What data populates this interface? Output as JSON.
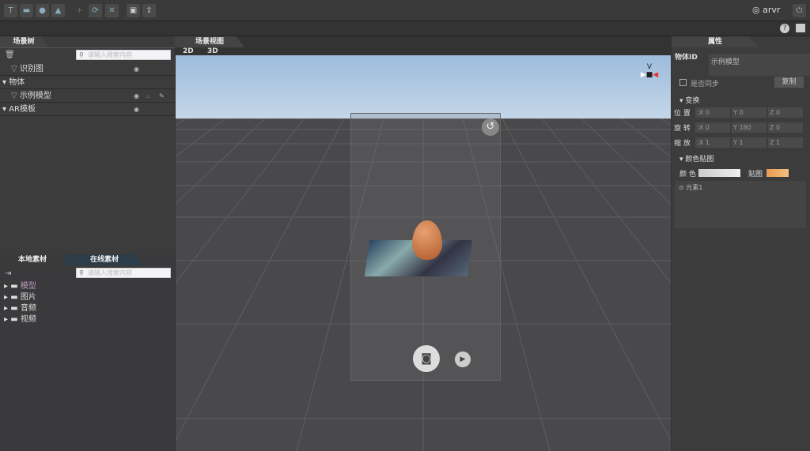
{
  "user": {
    "name": "arvr"
  },
  "toolbar": {
    "icons": [
      "text-icon",
      "camera-icon",
      "location-icon",
      "image-icon",
      "add-icon",
      "refresh-icon",
      "fullscreen-icon",
      "save-icon",
      "export-icon"
    ]
  },
  "scene_tree": {
    "tab": "场景树",
    "search_placeholder": "请输入搜索内容",
    "items": [
      {
        "label": "识别图",
        "type": "child"
      },
      {
        "label": "物体",
        "type": "group"
      },
      {
        "label": "示例模型",
        "type": "child"
      },
      {
        "label": "AR模板",
        "type": "group"
      }
    ]
  },
  "assets": {
    "tabs": [
      "本地素材",
      "在线素材"
    ],
    "search_placeholder": "请输入搜索内容",
    "folders": [
      "模型",
      "图片",
      "音频",
      "视频"
    ]
  },
  "scene_view": {
    "tab": "场景视图",
    "modes": [
      "2D",
      "3D"
    ]
  },
  "properties": {
    "tab": "属性",
    "object_id_label": "物体ID",
    "object_id": "示例模型",
    "sync_label": "是否同步",
    "copy_label": "复制",
    "transform": {
      "title": "变换",
      "rows": [
        {
          "label": "位 置",
          "x": "0",
          "y": "0",
          "z": "0"
        },
        {
          "label": "旋 转",
          "x": "0",
          "y": "180",
          "z": "0"
        },
        {
          "label": "缩 放",
          "x": "1",
          "y": "1",
          "z": "1"
        }
      ]
    },
    "material": {
      "title": "颜色贴图",
      "color_label": "颜 色",
      "texture_label": "贴图",
      "element": "元素1"
    }
  },
  "colors": {
    "sky": "#a8c4e0",
    "ground": "#4a4a4c",
    "panel": "#3c3c3c"
  }
}
